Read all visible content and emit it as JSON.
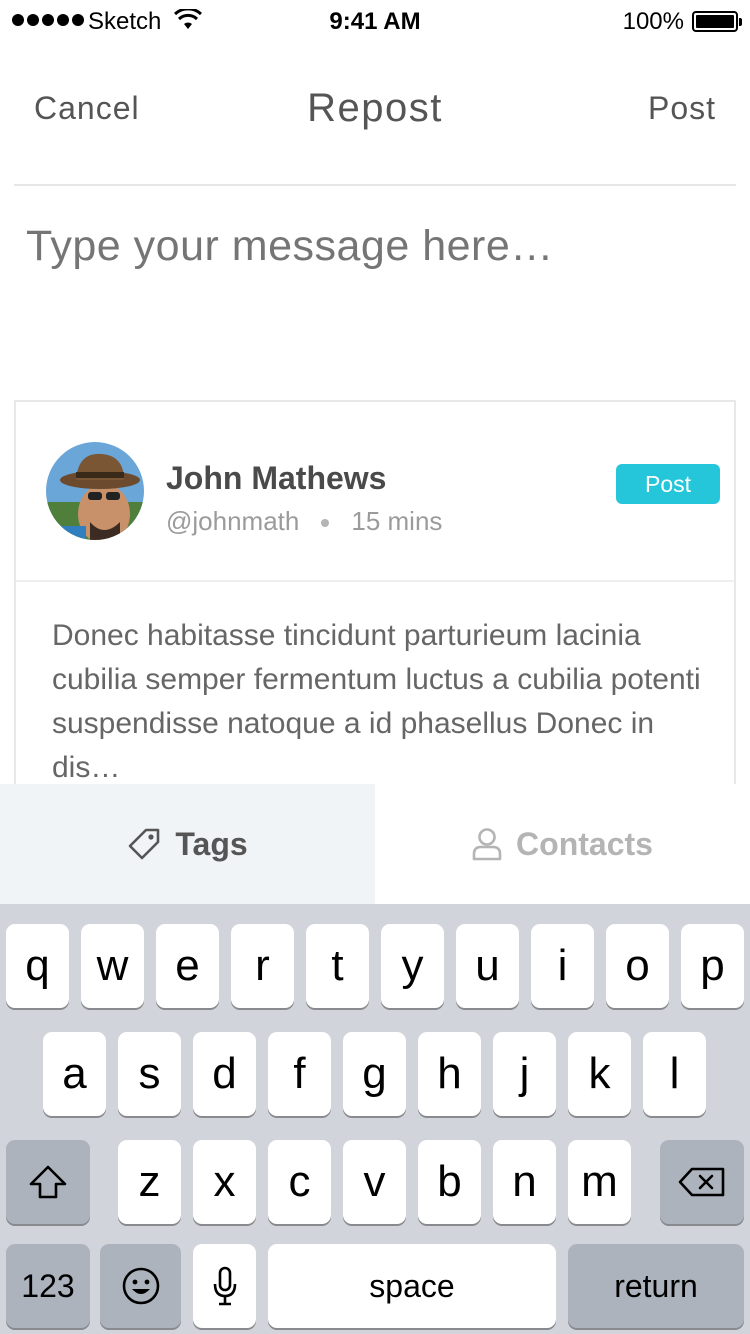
{
  "status_bar": {
    "carrier": "Sketch",
    "time": "9:41 AM",
    "battery": "100%"
  },
  "nav": {
    "cancel": "Cancel",
    "title": "Repost",
    "post": "Post"
  },
  "compose": {
    "placeholder": "Type your message here…"
  },
  "card": {
    "name": "John Mathews",
    "handle": "@johnmath",
    "time_ago": "15 mins",
    "badge": "Post",
    "body": "Donec habitasse tincidunt parturieum lacinia cubilia semper fermentum luctus a cubilia potenti suspendisse natoque a id phasellus Donec  in dis…"
  },
  "tabs": [
    {
      "label": "Tags",
      "icon": "tag-icon",
      "active": true
    },
    {
      "label": "Contacts",
      "icon": "person-icon",
      "active": false
    }
  ],
  "keyboard": {
    "row1": [
      "q",
      "w",
      "e",
      "r",
      "t",
      "y",
      "u",
      "i",
      "o",
      "p"
    ],
    "row2": [
      "a",
      "s",
      "d",
      "f",
      "g",
      "h",
      "j",
      "k",
      "l"
    ],
    "row3": [
      "z",
      "x",
      "c",
      "v",
      "b",
      "n",
      "m"
    ],
    "numbers": "123",
    "space": "space",
    "return": "return"
  },
  "colors": {
    "accent": "#26c6da",
    "active_tab_bg": "#f0f4f7",
    "keyboard_bg": "#d1d5db"
  }
}
